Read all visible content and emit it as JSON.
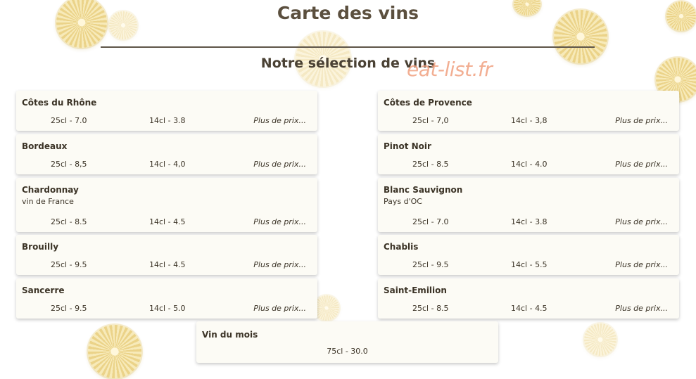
{
  "page": {
    "title": "Carte des vins",
    "subtitle": "Notre sélection de vins",
    "watermark": "eat-list.fr"
  },
  "wines_left": [
    {
      "name": "Côtes du Rhône",
      "sub": "",
      "price_25": "25cl - 7.0",
      "price_14": "14cl - 3.8",
      "more": "Plus de prix..."
    },
    {
      "name": "Bordeaux",
      "sub": "",
      "price_25": "25cl - 8,5",
      "price_14": "14cl - 4,0",
      "more": "Plus de prix..."
    },
    {
      "name": "Chardonnay",
      "sub": "vin de France",
      "price_25": "25cl - 8.5",
      "price_14": "14cl - 4.5",
      "more": "Plus de prix..."
    },
    {
      "name": "Brouilly",
      "sub": "",
      "price_25": "25cl - 9.5",
      "price_14": "14cl - 4.5",
      "more": "Plus de prix..."
    },
    {
      "name": "Sancerre",
      "sub": "",
      "price_25": "25cl - 9.5",
      "price_14": "14cl - 5.0",
      "more": "Plus de prix..."
    }
  ],
  "wines_right": [
    {
      "name": "Côtes de Provence",
      "sub": "",
      "price_25": "25cl - 7,0",
      "price_14": "14cl - 3,8",
      "more": "Plus de prix..."
    },
    {
      "name": "Pinot Noir",
      "sub": "",
      "price_25": "25cl - 8.5",
      "price_14": "14cl - 4.0",
      "more": "Plus de prix..."
    },
    {
      "name": "Blanc Sauvignon",
      "sub": "Pays d'OC",
      "price_25": "25cl - 7.0",
      "price_14": "14cl - 3.8",
      "more": "Plus de prix..."
    },
    {
      "name": "Chablis",
      "sub": "",
      "price_25": "25cl - 9.5",
      "price_14": "14cl - 5.5",
      "more": "Plus de prix..."
    },
    {
      "name": "Saint-Emilion",
      "sub": "",
      "price_25": "25cl - 8.5",
      "price_14": "14cl - 4.5",
      "more": "Plus de prix..."
    }
  ],
  "wine_of_month": {
    "name": "Vin du mois",
    "price": "75cl - 30.0"
  }
}
